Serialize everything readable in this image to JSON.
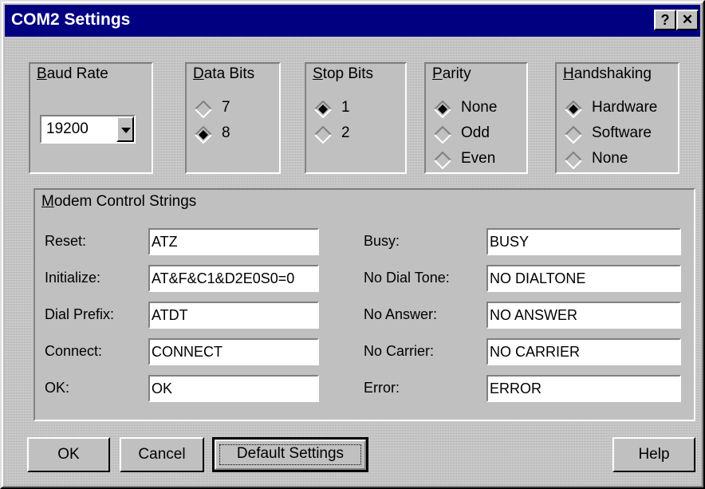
{
  "window": {
    "title": "COM2 Settings",
    "help_button": "?",
    "close_button": "✕"
  },
  "baud": {
    "label": "Baud Rate",
    "value": "19200"
  },
  "data_bits": {
    "label": "Data Bits",
    "options": [
      "7",
      "8"
    ],
    "selected": "8"
  },
  "stop_bits": {
    "label": "Stop Bits",
    "options": [
      "1",
      "2"
    ],
    "selected": "1"
  },
  "parity": {
    "label": "Parity",
    "options": [
      "None",
      "Odd",
      "Even"
    ],
    "selected": "None"
  },
  "handshaking": {
    "label": "Handshaking",
    "options": [
      "Hardware",
      "Software",
      "None"
    ],
    "selected": "Hardware"
  },
  "modem": {
    "label": "Modem Control Strings",
    "left": [
      {
        "label": "Reset:",
        "value": "ATZ"
      },
      {
        "label": "Initialize:",
        "value": "AT&F&C1&D2E0S0=0"
      },
      {
        "label": "Dial Prefix:",
        "value": "ATDT"
      },
      {
        "label": "Connect:",
        "value": "CONNECT"
      },
      {
        "label": "OK:",
        "value": "OK"
      }
    ],
    "right": [
      {
        "label": "Busy:",
        "value": "BUSY"
      },
      {
        "label": "No Dial Tone:",
        "value": "NO DIALTONE"
      },
      {
        "label": "No Answer:",
        "value": "NO ANSWER"
      },
      {
        "label": "No Carrier:",
        "value": "NO CARRIER"
      },
      {
        "label": "Error:",
        "value": "ERROR"
      }
    ]
  },
  "buttons": {
    "ok": "OK",
    "cancel": "Cancel",
    "default": "Default Settings",
    "help": "Help"
  }
}
